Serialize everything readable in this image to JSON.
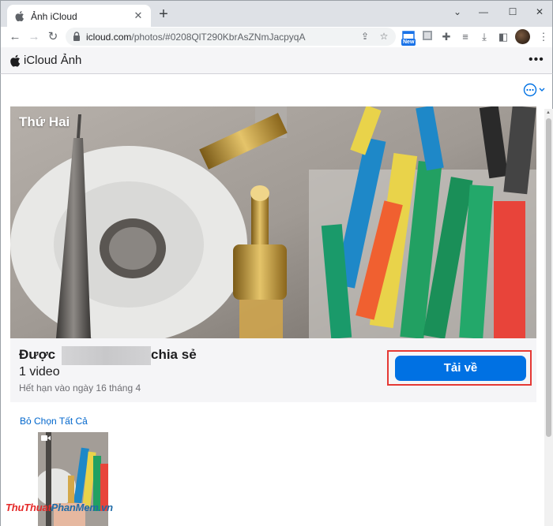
{
  "browser": {
    "tab_title": "Ảnh iCloud",
    "tab_close": "✕",
    "new_tab": "+",
    "window_controls": [
      "⌄",
      "—",
      "☐",
      "✕"
    ],
    "url_host": "icloud.com",
    "url_path": "/photos/#0208QlT290KbrAsZNmJacpyqA",
    "extension_badge": "New"
  },
  "app": {
    "brand": "iCloud Ảnh",
    "header_more": "•••"
  },
  "album": {
    "day_label": "Thứ Hai",
    "shared_prefix": "Được",
    "shared_suffix": "chia sẻ",
    "item_count": "1 video",
    "expiry": "Hết hạn vào ngày 16 tháng 4",
    "download_label": "Tải về",
    "deselect_all": "Bỏ Chọn Tất Cả"
  },
  "watermark": {
    "part1": "ThuThuat",
    "part2": "PhanMem",
    "part3": ".vn"
  },
  "colors": {
    "accent": "#0071e3",
    "highlight_box": "#e53935",
    "link": "#0066cc"
  }
}
